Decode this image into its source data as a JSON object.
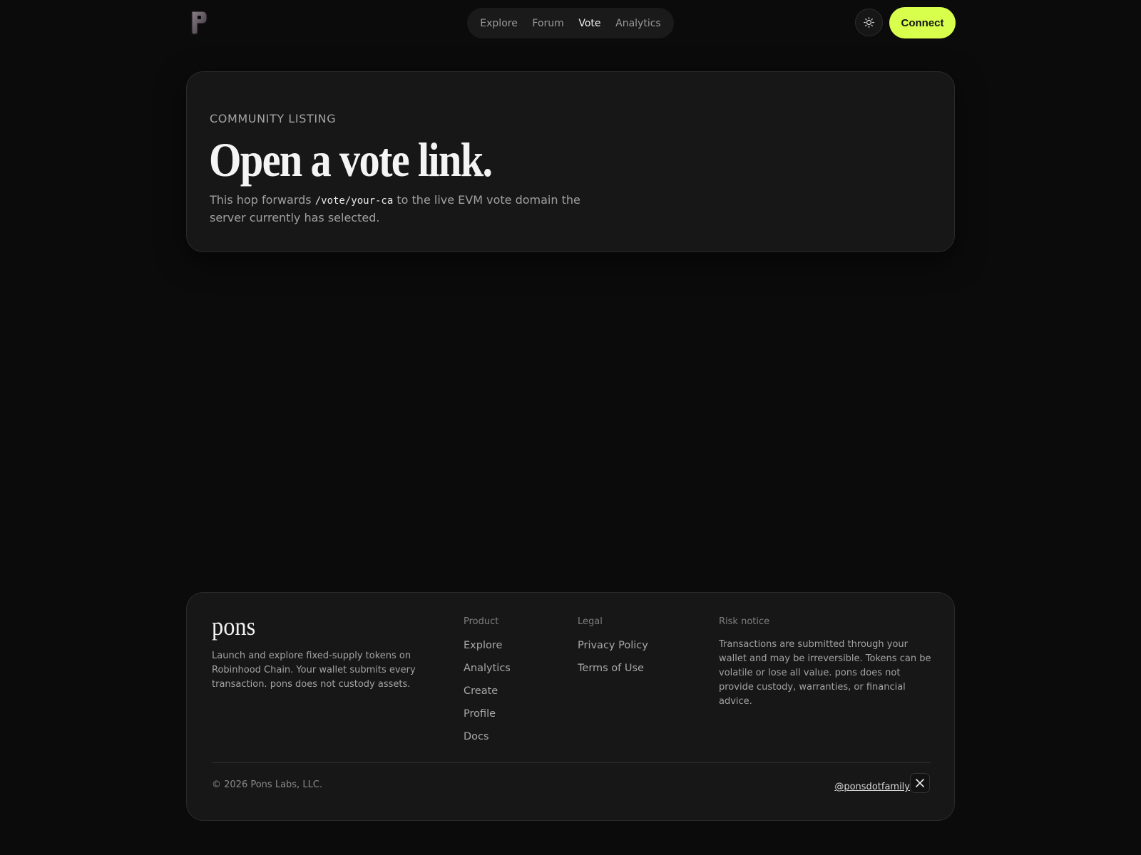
{
  "header": {
    "logo_icon": "p-logo-icon",
    "nav": [
      {
        "label": "Explore",
        "active": false
      },
      {
        "label": "Forum",
        "active": false
      },
      {
        "label": "Vote",
        "active": true
      },
      {
        "label": "Analytics",
        "active": false
      }
    ],
    "theme_icon": "sun-icon",
    "connect_label": "Connect",
    "accent_color": "#d9ff4d"
  },
  "hero": {
    "eyebrow": "COMMUNITY LISTING",
    "title": "Open a vote link.",
    "desc_before": "This hop forwards ",
    "desc_code": "/vote/your-ca",
    "desc_after": " to the live EVM vote domain the server currently has selected."
  },
  "footer": {
    "brand": "pons",
    "brand_desc": "Launch and explore fixed-supply tokens on Robinhood Chain. Your wallet submits every transaction. pons does not custody assets.",
    "product": {
      "heading": "Product",
      "links": [
        "Explore",
        "Analytics",
        "Create",
        "Profile",
        "Docs"
      ]
    },
    "legal": {
      "heading": "Legal",
      "links": [
        "Privacy Policy",
        "Terms of Use"
      ]
    },
    "risk": {
      "heading": "Risk notice",
      "text": "Transactions are submitted through your wallet and may be irreversible. Tokens can be volatile or lose all value. pons does not provide custody, warranties, or financial advice."
    },
    "copyright": "© 2026 Pons Labs, LLC.",
    "social_handle": "@ponsdotfamily",
    "social_icon": "x-logo-icon"
  }
}
